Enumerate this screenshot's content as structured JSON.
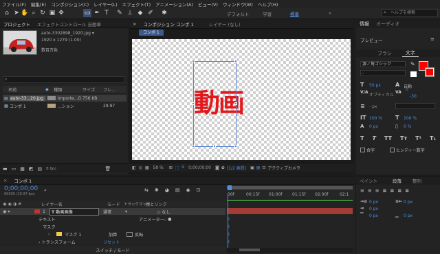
{
  "menu": [
    "ファイル(F)",
    "編集(E)",
    "コンポジション(C)",
    "レイヤー(L)",
    "エフェクト(T)",
    "アニメーション(A)",
    "ビュー(V)",
    "ウィンドウ(W)",
    "ヘルプ(H)"
  ],
  "workspaces": {
    "default": "デフォルト",
    "learn": "学習",
    "standard": "標準",
    "more": "»"
  },
  "search": {
    "placeholder": "ヘルプを検索"
  },
  "project": {
    "tab_project": "プロジェクト",
    "tab_effect": "エフェクトコントロール 自動車",
    "file_name": "auto-3302898_1920.jpg ▾",
    "file_dims": "1920 x 1279 (1.00)",
    "file_colors": "数百万色",
    "columns": {
      "name": "名前",
      "type": "種類",
      "size": "サイズ",
      "frame": "フレ..."
    },
    "rows": [
      {
        "name": "auto-33...20.jpg",
        "type": "Importe...G",
        "size": "756 KB",
        "frame": ""
      },
      {
        "name": "コンポ 1",
        "type": "...ション",
        "size": "",
        "frame": "29.97"
      }
    ],
    "bpc": "8 bpc"
  },
  "comp": {
    "tab_label": "コンポジション コンポ 1",
    "layer_tab": "レイヤー (なし)",
    "comp_chip": "コンポ 1",
    "text": "動画",
    "zoom": "50 %",
    "timecode": "0;00;00;00",
    "resolution": "(1/2 画質)",
    "camera": "アクティブカメラ"
  },
  "right": {
    "info_tab": "情報",
    "audio_tab": "オーディオ",
    "preview_tab": "プレビュー",
    "brush_tab": "ブラシ",
    "char_tab": "文字",
    "font": "源ノ角ゴシック",
    "style": "-",
    "size": "50 px",
    "leading": "自動",
    "tracking_val": "0",
    "kerning_label": "オプティカル",
    "tracking": "-30",
    "stroke_width": "- px",
    "stroke_mode": "",
    "vscale": "100 %",
    "hscale": "100 %",
    "baseline": "0 px",
    "tsume": "0 %",
    "text_styles": [
      "T",
      "T",
      "TT",
      "Tт",
      "T¹",
      "T₁"
    ],
    "ligature": "合字",
    "hindi": "ヒンディー数字",
    "colors": {
      "fill": "#ff0000",
      "stroke": "#ffffff",
      "accent": "#4d8fe0"
    }
  },
  "timeline": {
    "tab": "コンポ 1",
    "timecode": "0;00;00;00",
    "fps": "00000 (29.97 fps)",
    "headers": {
      "source": "レイヤー名",
      "mode": "モード",
      "trkmat": "トラックマット",
      "parent": "親とリンク"
    },
    "layer": {
      "num": "1",
      "name": "動画画像",
      "mode": "通常",
      "parent": "なし"
    },
    "text_prop": "テキスト",
    "anim_label": "アニメーター:",
    "mask": "マスク",
    "mask1": "マスク 1",
    "mask_mode": "加算",
    "invert": "反転",
    "transform": "トランスフォーム",
    "reset": "リセット",
    "ruler": [
      "00f",
      "00:15f",
      "01:00f",
      "01:15f",
      "02:00f",
      "02:1"
    ],
    "footer": "スイッチ / モード"
  },
  "paragraph": {
    "paint_tab": "ペイント",
    "para_tab": "段落",
    "align_tab": "整列",
    "px_values": [
      "0 px",
      "0 px",
      "0 px",
      "0 px",
      "0 px"
    ]
  }
}
